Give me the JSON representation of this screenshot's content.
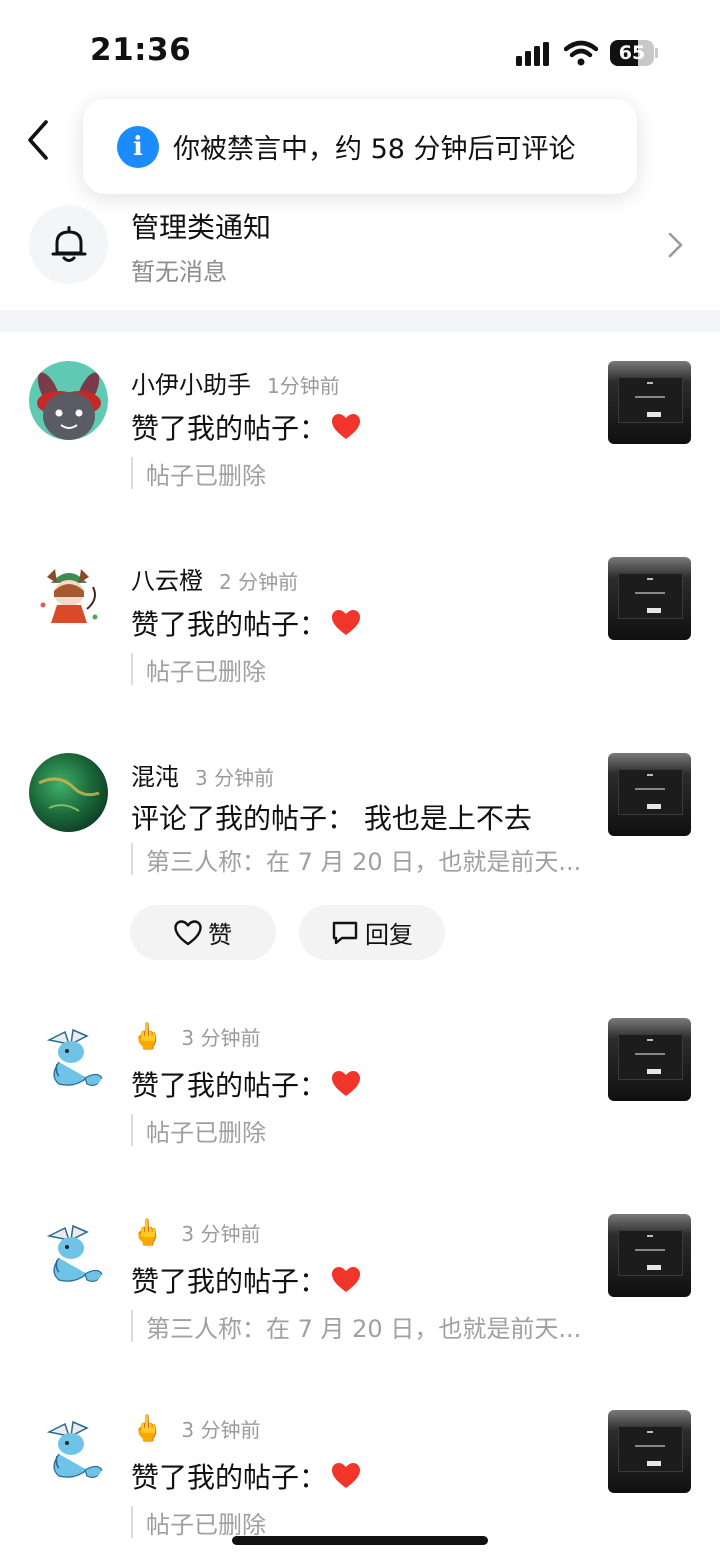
{
  "status_bar": {
    "time": "21:36",
    "battery": "65"
  },
  "toast": {
    "icon": "info-icon",
    "text": "你被禁言中，约 58 分钟后可评论"
  },
  "admin": {
    "title": "管理类通知",
    "subtitle": "暂无消息"
  },
  "notifications": [
    {
      "user": "小伊小助手",
      "time": "1分钟前",
      "action": "赞了我的帖子：",
      "quote": "帖子已删除"
    },
    {
      "user": "八云橙",
      "time": "2 分钟前",
      "action": "赞了我的帖子：",
      "quote": "帖子已删除"
    },
    {
      "user": "混沌",
      "time": "3 分钟前",
      "action": "评论了我的帖子：  我也是上不去",
      "quote": "第三人称：在 7 月 20 日，也就是前天...",
      "like_label": "赞",
      "reply_label": "回复"
    },
    {
      "user": "🖕",
      "time": "3 分钟前",
      "action": "赞了我的帖子：",
      "quote": "帖子已删除"
    },
    {
      "user": "🖕",
      "time": "3 分钟前",
      "action": "赞了我的帖子：",
      "quote": "第三人称：在 7 月 20 日，也就是前天..."
    },
    {
      "user": "🖕",
      "time": "3 分钟前",
      "action": "赞了我的帖子：",
      "quote": "帖子已删除"
    }
  ],
  "colors": {
    "heart": "#f2352b",
    "info": "#1a8cff",
    "divider": "#f4f5f8"
  }
}
